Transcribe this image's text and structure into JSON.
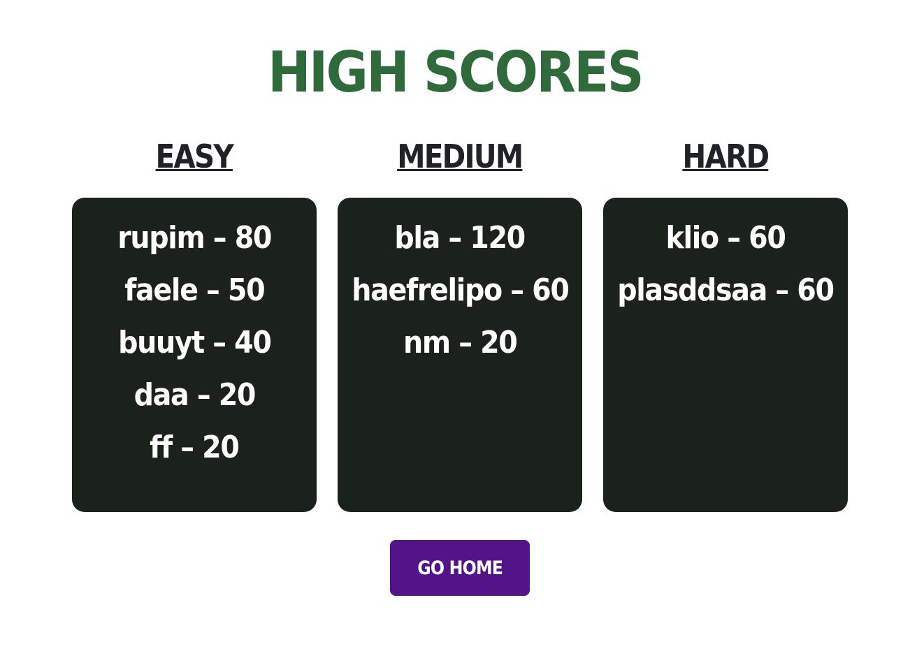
{
  "title": "HIGH SCORES",
  "colors": {
    "title": "#2f6b3a",
    "panel_bg": "#1b221b",
    "panel_text": "#ffffff",
    "heading": "#1f2227",
    "button_bg": "#53148a",
    "button_text": "#ffffff"
  },
  "columns": [
    {
      "heading": "EASY",
      "entries": [
        "rupim – 80",
        "faele – 50",
        "buuyt – 40",
        "daa – 20",
        "ff – 20"
      ]
    },
    {
      "heading": "MEDIUM",
      "entries": [
        "bla – 120",
        "haefrelipo – 60",
        "nm – 20"
      ]
    },
    {
      "heading": "HARD",
      "entries": [
        "klio – 60",
        "plasddsaa – 60"
      ]
    }
  ],
  "button": {
    "label": "GO HOME"
  }
}
